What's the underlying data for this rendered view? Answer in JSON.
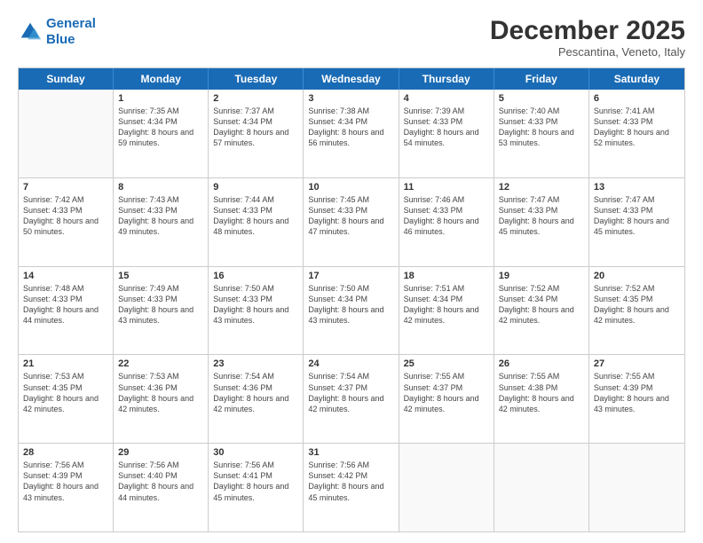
{
  "logo": {
    "line1": "General",
    "line2": "Blue"
  },
  "header": {
    "month": "December 2025",
    "location": "Pescantina, Veneto, Italy"
  },
  "weekdays": [
    "Sunday",
    "Monday",
    "Tuesday",
    "Wednesday",
    "Thursday",
    "Friday",
    "Saturday"
  ],
  "weeks": [
    [
      {
        "day": "",
        "sunrise": "",
        "sunset": "",
        "daylight": ""
      },
      {
        "day": "1",
        "sunrise": "Sunrise: 7:35 AM",
        "sunset": "Sunset: 4:34 PM",
        "daylight": "Daylight: 8 hours and 59 minutes."
      },
      {
        "day": "2",
        "sunrise": "Sunrise: 7:37 AM",
        "sunset": "Sunset: 4:34 PM",
        "daylight": "Daylight: 8 hours and 57 minutes."
      },
      {
        "day": "3",
        "sunrise": "Sunrise: 7:38 AM",
        "sunset": "Sunset: 4:34 PM",
        "daylight": "Daylight: 8 hours and 56 minutes."
      },
      {
        "day": "4",
        "sunrise": "Sunrise: 7:39 AM",
        "sunset": "Sunset: 4:33 PM",
        "daylight": "Daylight: 8 hours and 54 minutes."
      },
      {
        "day": "5",
        "sunrise": "Sunrise: 7:40 AM",
        "sunset": "Sunset: 4:33 PM",
        "daylight": "Daylight: 8 hours and 53 minutes."
      },
      {
        "day": "6",
        "sunrise": "Sunrise: 7:41 AM",
        "sunset": "Sunset: 4:33 PM",
        "daylight": "Daylight: 8 hours and 52 minutes."
      }
    ],
    [
      {
        "day": "7",
        "sunrise": "Sunrise: 7:42 AM",
        "sunset": "Sunset: 4:33 PM",
        "daylight": "Daylight: 8 hours and 50 minutes."
      },
      {
        "day": "8",
        "sunrise": "Sunrise: 7:43 AM",
        "sunset": "Sunset: 4:33 PM",
        "daylight": "Daylight: 8 hours and 49 minutes."
      },
      {
        "day": "9",
        "sunrise": "Sunrise: 7:44 AM",
        "sunset": "Sunset: 4:33 PM",
        "daylight": "Daylight: 8 hours and 48 minutes."
      },
      {
        "day": "10",
        "sunrise": "Sunrise: 7:45 AM",
        "sunset": "Sunset: 4:33 PM",
        "daylight": "Daylight: 8 hours and 47 minutes."
      },
      {
        "day": "11",
        "sunrise": "Sunrise: 7:46 AM",
        "sunset": "Sunset: 4:33 PM",
        "daylight": "Daylight: 8 hours and 46 minutes."
      },
      {
        "day": "12",
        "sunrise": "Sunrise: 7:47 AM",
        "sunset": "Sunset: 4:33 PM",
        "daylight": "Daylight: 8 hours and 45 minutes."
      },
      {
        "day": "13",
        "sunrise": "Sunrise: 7:47 AM",
        "sunset": "Sunset: 4:33 PM",
        "daylight": "Daylight: 8 hours and 45 minutes."
      }
    ],
    [
      {
        "day": "14",
        "sunrise": "Sunrise: 7:48 AM",
        "sunset": "Sunset: 4:33 PM",
        "daylight": "Daylight: 8 hours and 44 minutes."
      },
      {
        "day": "15",
        "sunrise": "Sunrise: 7:49 AM",
        "sunset": "Sunset: 4:33 PM",
        "daylight": "Daylight: 8 hours and 43 minutes."
      },
      {
        "day": "16",
        "sunrise": "Sunrise: 7:50 AM",
        "sunset": "Sunset: 4:33 PM",
        "daylight": "Daylight: 8 hours and 43 minutes."
      },
      {
        "day": "17",
        "sunrise": "Sunrise: 7:50 AM",
        "sunset": "Sunset: 4:34 PM",
        "daylight": "Daylight: 8 hours and 43 minutes."
      },
      {
        "day": "18",
        "sunrise": "Sunrise: 7:51 AM",
        "sunset": "Sunset: 4:34 PM",
        "daylight": "Daylight: 8 hours and 42 minutes."
      },
      {
        "day": "19",
        "sunrise": "Sunrise: 7:52 AM",
        "sunset": "Sunset: 4:34 PM",
        "daylight": "Daylight: 8 hours and 42 minutes."
      },
      {
        "day": "20",
        "sunrise": "Sunrise: 7:52 AM",
        "sunset": "Sunset: 4:35 PM",
        "daylight": "Daylight: 8 hours and 42 minutes."
      }
    ],
    [
      {
        "day": "21",
        "sunrise": "Sunrise: 7:53 AM",
        "sunset": "Sunset: 4:35 PM",
        "daylight": "Daylight: 8 hours and 42 minutes."
      },
      {
        "day": "22",
        "sunrise": "Sunrise: 7:53 AM",
        "sunset": "Sunset: 4:36 PM",
        "daylight": "Daylight: 8 hours and 42 minutes."
      },
      {
        "day": "23",
        "sunrise": "Sunrise: 7:54 AM",
        "sunset": "Sunset: 4:36 PM",
        "daylight": "Daylight: 8 hours and 42 minutes."
      },
      {
        "day": "24",
        "sunrise": "Sunrise: 7:54 AM",
        "sunset": "Sunset: 4:37 PM",
        "daylight": "Daylight: 8 hours and 42 minutes."
      },
      {
        "day": "25",
        "sunrise": "Sunrise: 7:55 AM",
        "sunset": "Sunset: 4:37 PM",
        "daylight": "Daylight: 8 hours and 42 minutes."
      },
      {
        "day": "26",
        "sunrise": "Sunrise: 7:55 AM",
        "sunset": "Sunset: 4:38 PM",
        "daylight": "Daylight: 8 hours and 42 minutes."
      },
      {
        "day": "27",
        "sunrise": "Sunrise: 7:55 AM",
        "sunset": "Sunset: 4:39 PM",
        "daylight": "Daylight: 8 hours and 43 minutes."
      }
    ],
    [
      {
        "day": "28",
        "sunrise": "Sunrise: 7:56 AM",
        "sunset": "Sunset: 4:39 PM",
        "daylight": "Daylight: 8 hours and 43 minutes."
      },
      {
        "day": "29",
        "sunrise": "Sunrise: 7:56 AM",
        "sunset": "Sunset: 4:40 PM",
        "daylight": "Daylight: 8 hours and 44 minutes."
      },
      {
        "day": "30",
        "sunrise": "Sunrise: 7:56 AM",
        "sunset": "Sunset: 4:41 PM",
        "daylight": "Daylight: 8 hours and 45 minutes."
      },
      {
        "day": "31",
        "sunrise": "Sunrise: 7:56 AM",
        "sunset": "Sunset: 4:42 PM",
        "daylight": "Daylight: 8 hours and 45 minutes."
      },
      {
        "day": "",
        "sunrise": "",
        "sunset": "",
        "daylight": ""
      },
      {
        "day": "",
        "sunrise": "",
        "sunset": "",
        "daylight": ""
      },
      {
        "day": "",
        "sunrise": "",
        "sunset": "",
        "daylight": ""
      }
    ]
  ]
}
